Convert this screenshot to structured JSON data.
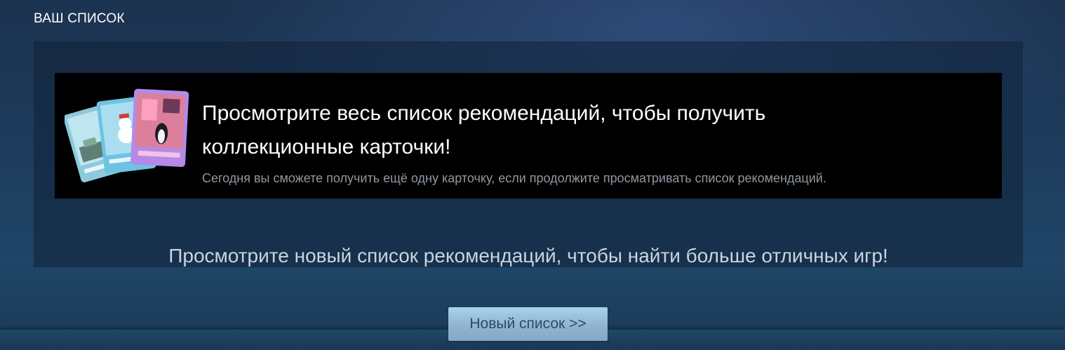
{
  "section": {
    "title": "ВАШ СПИСОК"
  },
  "cards_banner": {
    "headline": "Просмотрите весь список рекомендаций, чтобы получить коллекционные карточки!",
    "subtext": "Сегодня вы сможете получить ещё одну карточку, если продолжите просматривать список рекомендаций.",
    "image_icon": "trading-cards-icon"
  },
  "queue": {
    "prompt": "Просмотрите новый список рекомендаций, чтобы найти больше отличных игр!",
    "button_label": "Новый список >>"
  },
  "colors": {
    "background": "#1d3b5c",
    "banner_background": "#000000",
    "headline_text": "#ffffff",
    "subtext": "#8f98a0",
    "prompt_text": "#c7d5e0",
    "button_top": "#aad2ea",
    "button_bottom": "#86a9c5",
    "button_text": "#2e4a66"
  }
}
